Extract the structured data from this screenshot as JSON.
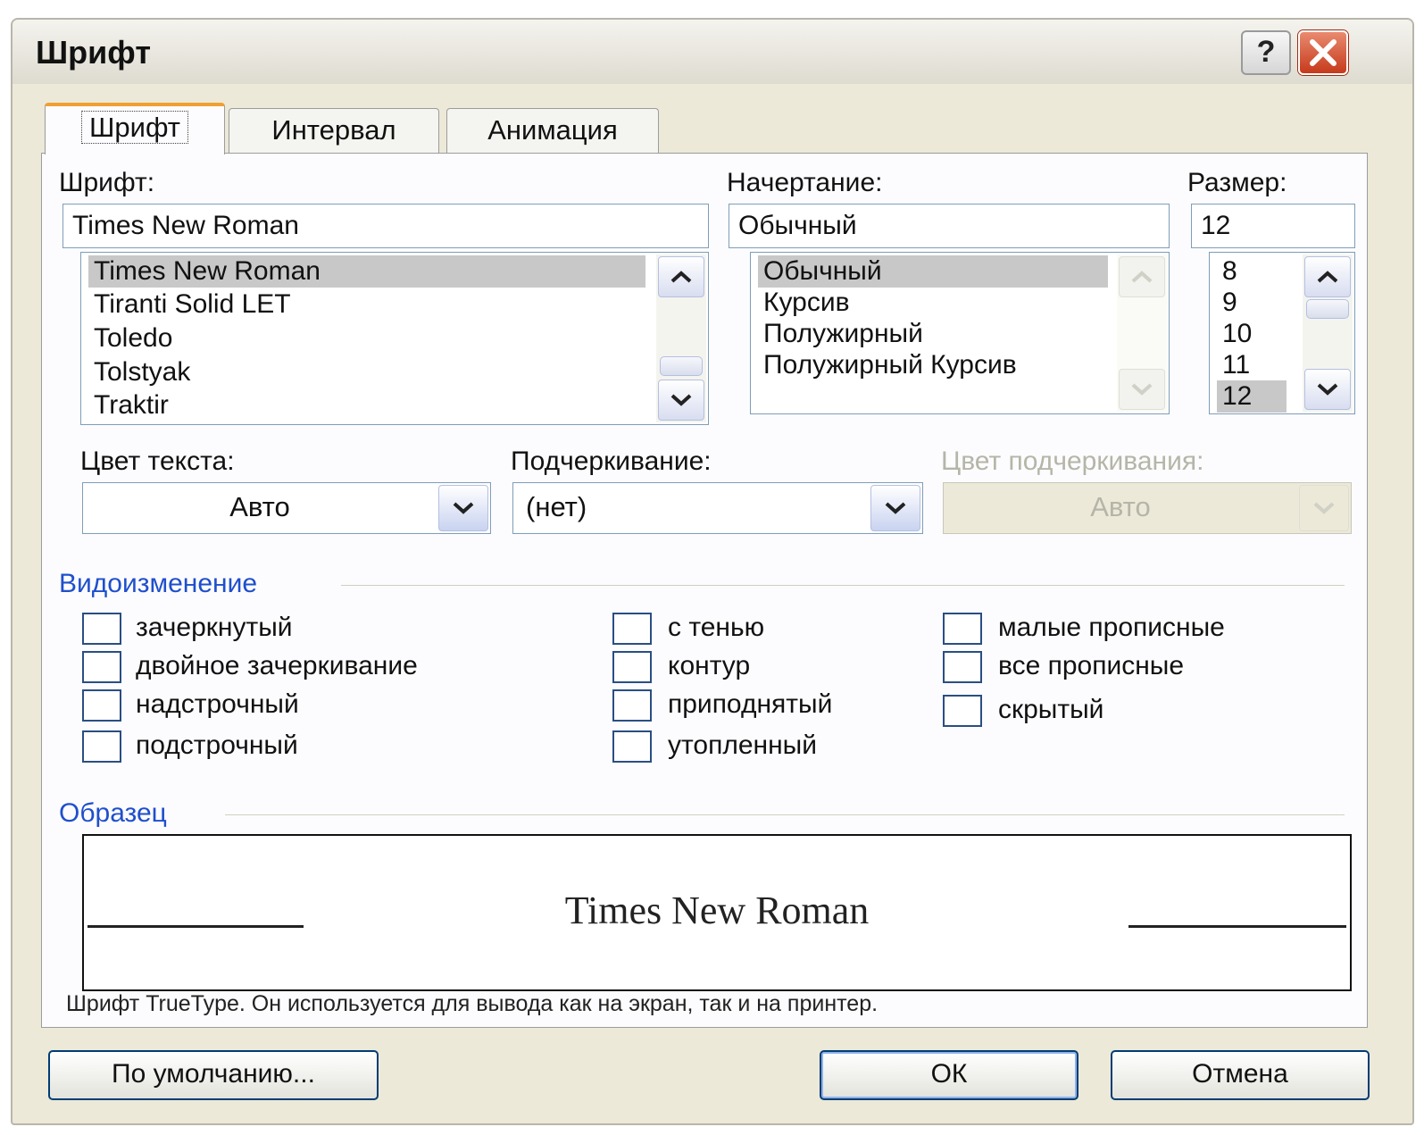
{
  "window": {
    "title": "Шрифт"
  },
  "titlebar": {
    "help_label": "?"
  },
  "tabs": [
    {
      "label": "Шрифт",
      "active": true
    },
    {
      "label": "Интервал",
      "active": false
    },
    {
      "label": "Анимация",
      "active": false
    }
  ],
  "font": {
    "label": "Шрифт:",
    "value": "Times New Roman",
    "items": [
      "Times New Roman",
      "Tiranti Solid LET",
      "Toledo",
      "Tolstyak",
      "Traktir"
    ],
    "selected": "Times New Roman"
  },
  "style": {
    "label": "Начертание:",
    "value": "Обычный",
    "items": [
      "Обычный",
      "Курсив",
      "Полужирный",
      "Полужирный Курсив"
    ],
    "selected": "Обычный"
  },
  "size": {
    "label": "Размер:",
    "value": "12",
    "items": [
      "8",
      "9",
      "10",
      "11",
      "12"
    ],
    "selected": "12"
  },
  "text_color": {
    "label": "Цвет текста:",
    "value": "Авто"
  },
  "underline": {
    "label": "Подчеркивание:",
    "value": "(нет)"
  },
  "underline_color": {
    "label": "Цвет подчеркивания:",
    "value": "Авто",
    "disabled": true
  },
  "effects": {
    "title": "Видоизменение",
    "col1": [
      "зачеркнутый",
      "двойное зачеркивание",
      "надстрочный",
      "подстрочный"
    ],
    "col2": [
      "с тенью",
      "контур",
      "приподнятый",
      "утопленный"
    ],
    "col3": [
      "малые прописные",
      "все прописные",
      "скрытый"
    ]
  },
  "preview": {
    "title": "Образец",
    "sample": "Times New Roman",
    "note": "Шрифт TrueType. Он используется для вывода как на экран, так и на принтер."
  },
  "buttons": {
    "default": "По умолчанию...",
    "ok": "ОК",
    "cancel": "Отмена"
  },
  "colors": {
    "accent_tab": "#f0a030",
    "group_title": "#1f4fcc",
    "close_button": "#c63a1b"
  }
}
